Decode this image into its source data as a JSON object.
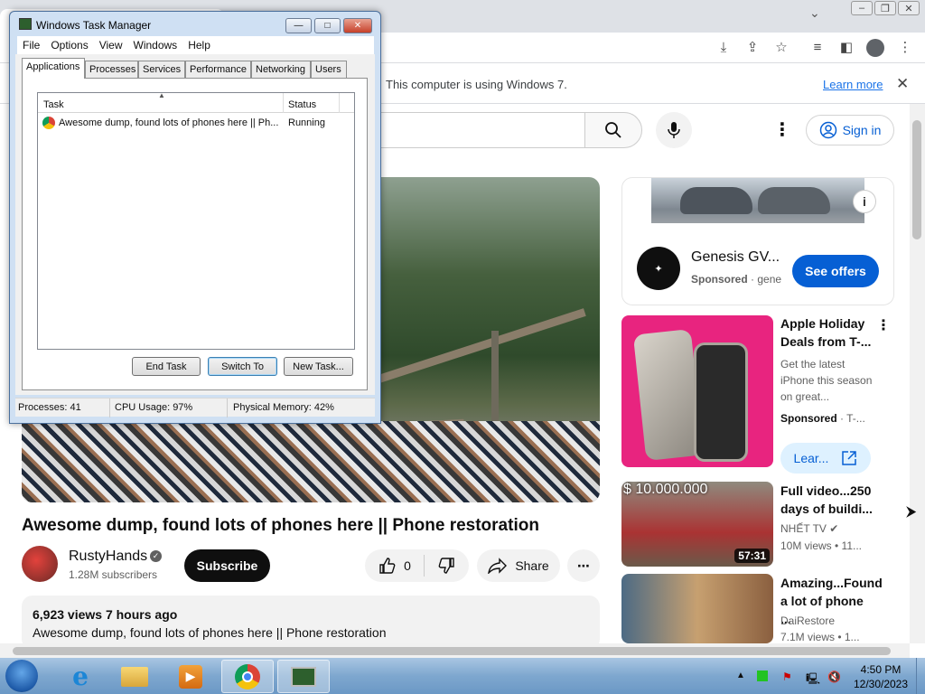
{
  "browser": {
    "info_bar": {
      "message": "This computer is using Windows 7.",
      "learn_more": "Learn more",
      "close_icon": "close-icon"
    },
    "window_buttons": [
      "minimize",
      "restore",
      "close"
    ]
  },
  "youtube": {
    "header": {
      "sign_in": "Sign in"
    },
    "video": {
      "title": "Awesome dump, found lots of phones here || Phone restoration",
      "channel": "RustyHands",
      "subscribers": "1.28M subscribers",
      "subscribe": "Subscribe",
      "likes": "0",
      "share": "Share",
      "views_time": "6,923 views  7 hours ago",
      "description": "Awesome dump, found lots of phones here || Phone restoration"
    },
    "ad": {
      "title": "Genesis GV...",
      "sponsored": "Sponsored",
      "advertiser": "gene",
      "cta": "See offers"
    },
    "recommendations": [
      {
        "title": "Apple Holiday Deals from T-...",
        "desc": "Get the latest iPhone this season on great...",
        "sponsored": "Sponsored",
        "advertiser": "T-...",
        "cta": "Lear..."
      },
      {
        "title": "Full video...250 days of buildi...",
        "channel": "NHẾT TV",
        "meta": "10M views  • 11...",
        "duration": "57:31",
        "overlay": "$ 10.000.000"
      },
      {
        "title": "Amazing...Found a lot of phone ...",
        "channel": "DaiRestore",
        "meta": "7.1M views  • 1..."
      }
    ]
  },
  "task_manager": {
    "title": "Windows Task Manager",
    "menu": [
      "File",
      "Options",
      "View",
      "Windows",
      "Help"
    ],
    "tabs": [
      "Applications",
      "Processes",
      "Services",
      "Performance",
      "Networking",
      "Users"
    ],
    "columns": {
      "task": "Task",
      "status": "Status"
    },
    "rows": [
      {
        "task": "Awesome dump, found lots of phones here || Ph...",
        "status": "Running"
      }
    ],
    "buttons": {
      "end_task": "End Task",
      "switch_to": "Switch To",
      "new_task": "New Task..."
    },
    "status": {
      "processes": "Processes: 41",
      "cpu": "CPU Usage: 97%",
      "memory": "Physical Memory: 42%"
    }
  },
  "taskbar": {
    "time": "4:50 PM",
    "date": "12/30/2023"
  }
}
